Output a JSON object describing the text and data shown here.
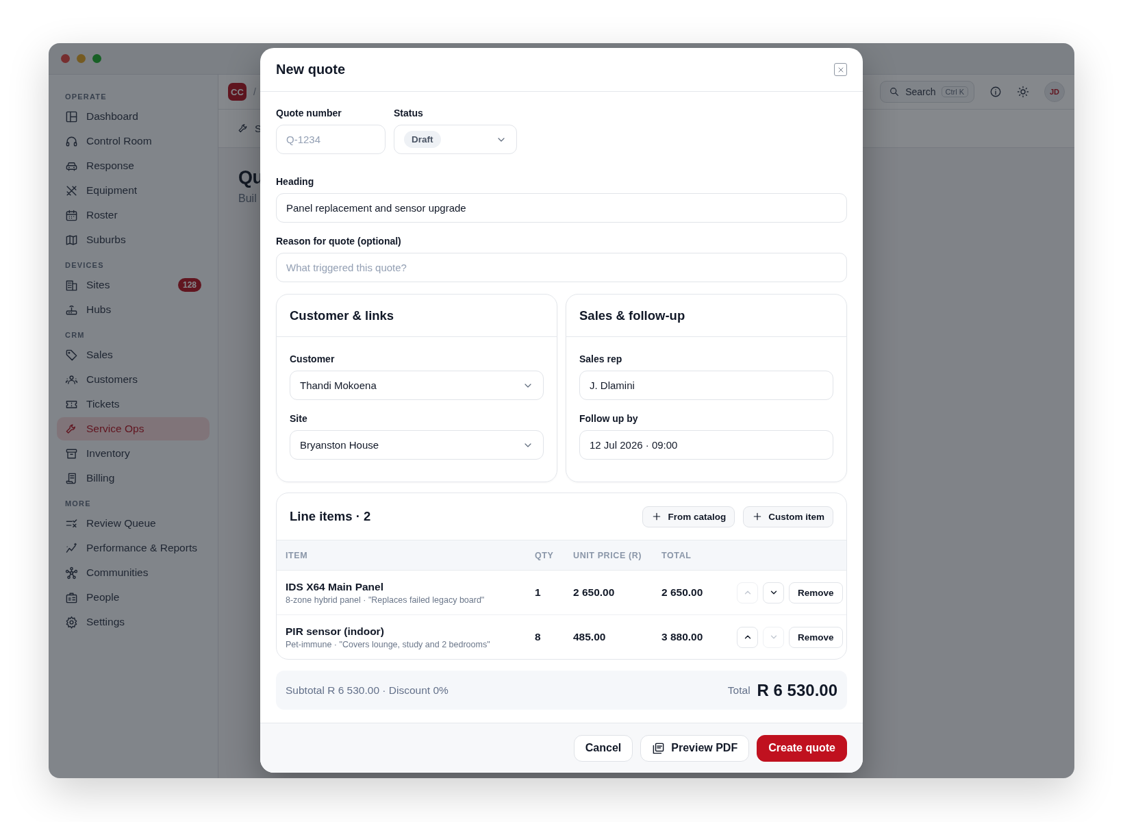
{
  "sidebar": {
    "sections": [
      {
        "label": "OPERATE",
        "items": [
          {
            "label": "Dashboard",
            "selected": false
          },
          {
            "label": "Control Room",
            "selected": false
          },
          {
            "label": "Response",
            "selected": false
          },
          {
            "label": "Equipment",
            "selected": false
          },
          {
            "label": "Roster",
            "selected": false
          },
          {
            "label": "Suburbs",
            "selected": false
          }
        ]
      },
      {
        "label": "DEVICES",
        "items": [
          {
            "label": "Sites",
            "selected": false,
            "badge": "128"
          },
          {
            "label": "Hubs",
            "selected": false
          }
        ]
      },
      {
        "label": "CRM",
        "items": [
          {
            "label": "Sales",
            "selected": false
          },
          {
            "label": "Customers",
            "selected": false
          },
          {
            "label": "Tickets",
            "selected": false
          },
          {
            "label": "Service Ops",
            "selected": true
          },
          {
            "label": "Inventory",
            "selected": false
          },
          {
            "label": "Billing",
            "selected": false
          }
        ]
      },
      {
        "label": "MORE",
        "items": [
          {
            "label": "Review Queue",
            "selected": false
          },
          {
            "label": "Performance & Reports",
            "selected": false
          },
          {
            "label": "Communities",
            "selected": false
          },
          {
            "label": "People",
            "selected": false
          },
          {
            "label": "Settings",
            "selected": false
          }
        ]
      }
    ]
  },
  "header": {
    "logo": "CC",
    "separator": "/",
    "search": {
      "label": "Search",
      "shortcut": "Ctrl K"
    },
    "avatar": "JD"
  },
  "page": {
    "tab": "S",
    "title": "Qu",
    "subtitle": "Buil"
  },
  "modal": {
    "title": "New quote",
    "quote_number": {
      "label": "Quote number",
      "placeholder": "Q-1234"
    },
    "status": {
      "label": "Status",
      "value": "Draft"
    },
    "heading": {
      "label": "Heading",
      "value": "Panel replacement and sensor upgrade"
    },
    "reason": {
      "label": "Reason for quote (optional)",
      "placeholder": "What triggered this quote?"
    },
    "cards": [
      {
        "title": "Customer & links",
        "fields": [
          {
            "label": "Customer",
            "value": "Thandi Mokoena",
            "kind": "select"
          },
          {
            "label": "Site",
            "value": "Bryanston House",
            "kind": "select"
          }
        ]
      },
      {
        "title": "Sales & follow-up",
        "fields": [
          {
            "label": "Sales rep",
            "value": "J. Dlamini",
            "kind": "text"
          },
          {
            "label": "Follow up by",
            "value": "12 Jul 2026 · 09:00",
            "kind": "text"
          }
        ]
      }
    ],
    "line_items": {
      "title": "Line items · 2",
      "buttons": [
        "From catalog",
        "Custom item"
      ],
      "columns": [
        "ITEM",
        "QTY",
        "UNIT PRICE (R)",
        "TOTAL"
      ],
      "rows": [
        {
          "name": "IDS X64 Main Panel",
          "description": "8-zone hybrid panel · \"Replaces failed legacy board\"",
          "qty": "1",
          "unit_price": "2 650.00",
          "total": "2 650.00",
          "move_up_disabled": true,
          "move_down_disabled": false,
          "remove": "Remove"
        },
        {
          "name": "PIR sensor (indoor)",
          "description": "Pet-immune · \"Covers lounge, study and 2 bedrooms\"",
          "qty": "8",
          "unit_price": "485.00",
          "total": "3 880.00",
          "move_up_disabled": false,
          "move_down_disabled": true,
          "remove": "Remove"
        }
      ]
    },
    "summary": {
      "text": "Subtotal R 6 530.00 · Discount 0%",
      "total_label": "Total",
      "total": "R 6 530.00"
    },
    "footer_buttons": [
      {
        "label": "Cancel",
        "kind": "secondary"
      },
      {
        "label": "Preview PDF",
        "kind": "pdf"
      },
      {
        "label": "Create quote",
        "kind": "primary"
      }
    ]
  }
}
